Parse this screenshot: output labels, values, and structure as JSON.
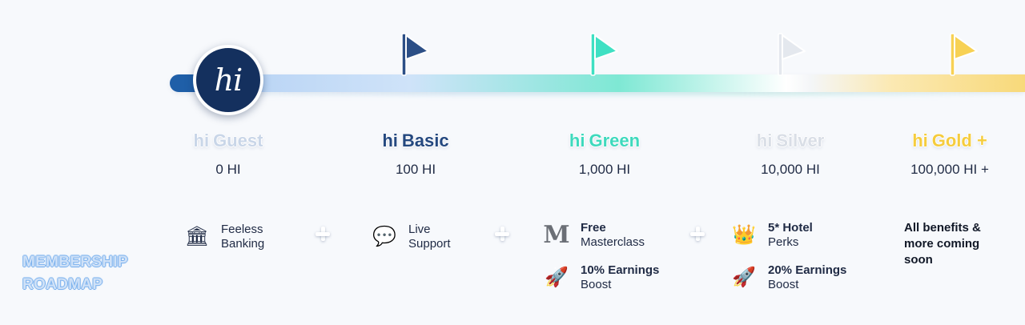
{
  "logo": {
    "text": "hi"
  },
  "tiers": [
    {
      "prefix": "hi",
      "name": "Guest",
      "points": "0 HI",
      "color": "#c9d6e8"
    },
    {
      "prefix": "hi",
      "name": "Basic",
      "points": "100 HI",
      "color": "#24487f"
    },
    {
      "prefix": "hi",
      "name": "Green",
      "points": "1,000 HI",
      "color": "#3ed9bd"
    },
    {
      "prefix": "hi",
      "name": "Silver",
      "points": "10,000 HI",
      "color": "#d9dee6"
    },
    {
      "prefix": "hi",
      "name": "Gold +",
      "points": "100,000 HI +",
      "color": "#f5cc3d"
    }
  ],
  "flags": [
    {
      "color": "#2c4f86",
      "icon": "flag-icon"
    },
    {
      "color": "#3fe0c3",
      "icon": "flag-icon"
    },
    {
      "color": "#e4e8ee",
      "icon": "flag-icon"
    },
    {
      "color": "#f7d154",
      "icon": "flag-icon"
    }
  ],
  "perks": {
    "guest": [
      {
        "line1": "Feeless",
        "line2": "Banking",
        "icon": "bank-icon"
      }
    ],
    "basic": [
      {
        "line1": "Live",
        "line2": "Support",
        "icon": "speech-bubble-icon"
      }
    ],
    "green": [
      {
        "line1": "Free",
        "line2": "Masterclass",
        "icon": "masterclass-icon"
      },
      {
        "line1": "10% Earnings",
        "line2": "Boost",
        "icon": "rocket-icon"
      }
    ],
    "silver": [
      {
        "line1": "5* Hotel",
        "line2": "Perks",
        "icon": "crown-icon"
      },
      {
        "line1": "20% Earnings",
        "line2": "Boost",
        "icon": "rocket-icon"
      }
    ],
    "gold": {
      "note": "All benefits & more coming soon"
    }
  },
  "roadmap": {
    "line1": "MEMBERSHIP",
    "line2": "ROADMAP"
  }
}
